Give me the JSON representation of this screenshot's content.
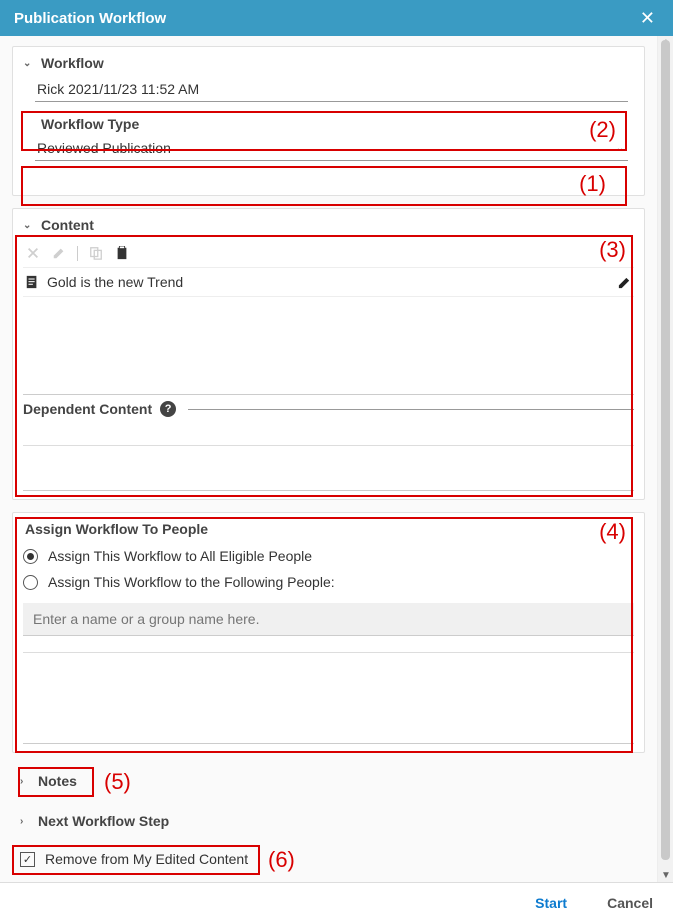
{
  "header": {
    "title": "Publication Workflow"
  },
  "workflow": {
    "section_label": "Workflow",
    "name_value": "Rick 2021/11/23 11:52 AM",
    "type_label": "Workflow Type",
    "type_value": "Reviewed Publication"
  },
  "content": {
    "section_label": "Content",
    "item_title": "Gold is the new Trend",
    "dependent_label": "Dependent Content"
  },
  "assign": {
    "section_label": "Assign Workflow To People",
    "opt_all": "Assign This Workflow to All Eligible People",
    "opt_following": "Assign This Workflow to the Following People:",
    "name_placeholder": "Enter a name or a group name here."
  },
  "notes": {
    "section_label": "Notes"
  },
  "next_step": {
    "section_label": "Next Workflow Step"
  },
  "remove_edited": {
    "label": "Remove from My Edited Content",
    "checked": true
  },
  "footer": {
    "start": "Start",
    "cancel": "Cancel"
  },
  "annotations": {
    "a1": "(1)",
    "a2": "(2)",
    "a3": "(3)",
    "a4": "(4)",
    "a5": "(5)",
    "a6": "(6)"
  }
}
